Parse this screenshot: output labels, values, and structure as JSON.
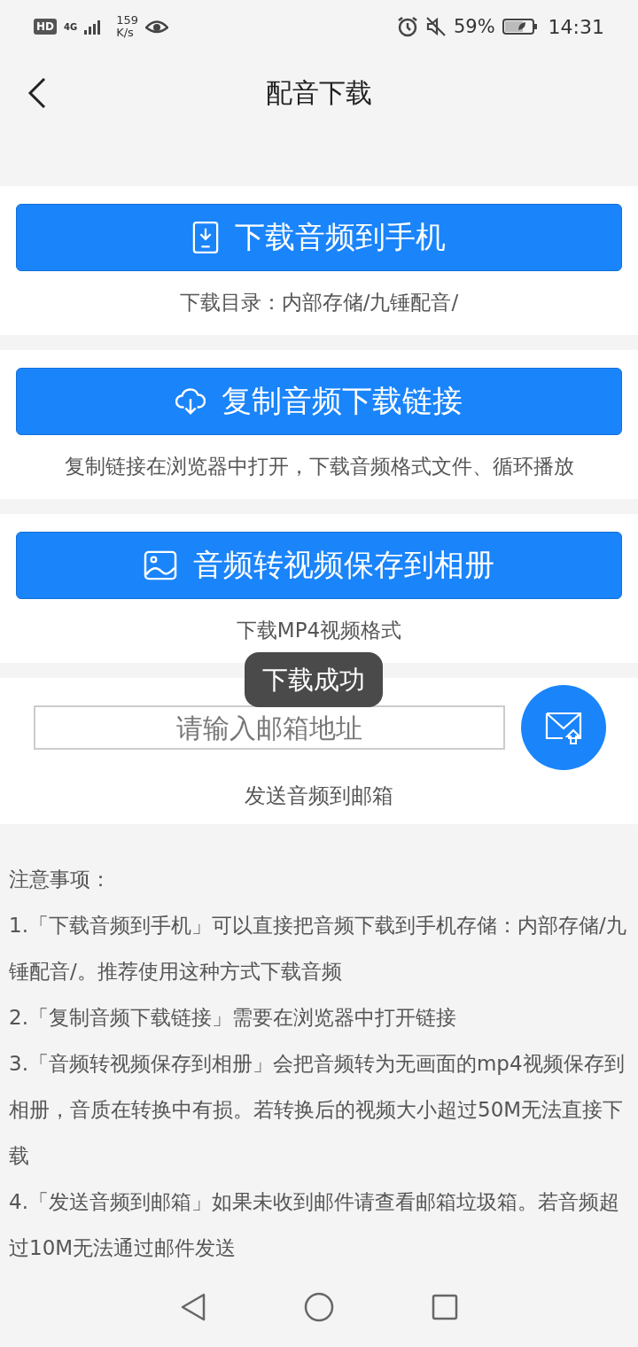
{
  "status_bar": {
    "hd": "HD",
    "network": "4G",
    "speed": "159",
    "speed_unit": "K/s",
    "battery": "59%",
    "time": "14:31"
  },
  "header": {
    "title": "配音下载"
  },
  "actions": [
    {
      "label": "下载音频到手机",
      "kind": "phone",
      "note": "下载目录：内部存储/九锤配音/"
    },
    {
      "label": "复制音频下载链接",
      "kind": "cloud",
      "note": "复制链接在浏览器中打开，下载音频格式文件、循环播放"
    },
    {
      "label": "音频转视频保存到相册",
      "kind": "image",
      "note": "下载MP4视频格式"
    }
  ],
  "email": {
    "placeholder": "请输入邮箱地址",
    "caption": "发送音频到邮箱"
  },
  "toast": {
    "text": "下载成功"
  },
  "notes": {
    "title": "注意事项：",
    "items": [
      "1.「下载音频到手机」可以直接把音频下载到手机存储：内部存储/九锤配音/。推荐使用这种方式下载音频",
      "2.「复制音频下载链接」需要在浏览器中打开链接",
      "3.「音频转视频保存到相册」会把音频转为无画面的mp4视频保存到相册，音质在转换中有损。若转换后的视频大小超过50M无法直接下载",
      "4.「发送音频到邮箱」如果未收到邮件请查看邮箱垃圾箱。若音频超过10M无法通过邮件发送"
    ]
  }
}
